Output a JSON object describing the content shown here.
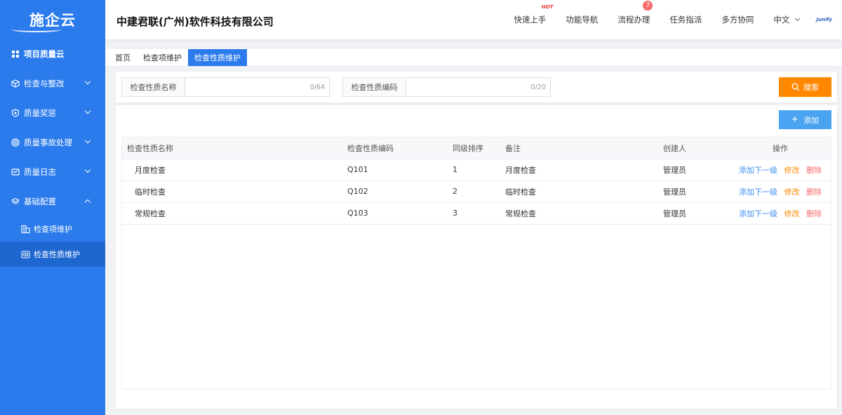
{
  "logo": {
    "text": "施企云"
  },
  "sidebar": {
    "items": [
      {
        "label": "项目质量云",
        "icon": "grid-icon"
      },
      {
        "label": "检查与整改",
        "icon": "cube-icon"
      },
      {
        "label": "质量奖惩",
        "icon": "shield-icon"
      },
      {
        "label": "质量事故处理",
        "icon": "target-icon"
      },
      {
        "label": "质量日志",
        "icon": "log-icon"
      },
      {
        "label": "基础配置",
        "icon": "layers-icon"
      }
    ],
    "sub_items": [
      {
        "label": "检查项维护",
        "icon": "building-icon"
      },
      {
        "label": "检查性质维护",
        "icon": "eye-card-icon"
      }
    ]
  },
  "header": {
    "company": "中建君联(广州)软件科技有限公司",
    "nav": {
      "quick_start": "快速上手",
      "hot": "HOT",
      "func_nav": "功能导航",
      "process": "流程办理",
      "process_badge": "7",
      "task": "任务指派",
      "collab": "多方协同",
      "lang": "中文",
      "brand": "Junify"
    }
  },
  "tabs": [
    {
      "label": "首页"
    },
    {
      "label": "检查项维护"
    },
    {
      "label": "检查性质维护"
    }
  ],
  "search": {
    "name_label": "检查性质名称",
    "name_count": "0/64",
    "code_label": "检查性质编码",
    "code_count": "0/20",
    "button": "搜索"
  },
  "toolbar": {
    "add": "添加"
  },
  "table": {
    "headers": {
      "name": "检查性质名称",
      "code": "检查性质编码",
      "order": "同级排序",
      "remark": "备注",
      "creator": "创建人",
      "op": "操作"
    },
    "rows": [
      {
        "name": "月度检查",
        "code": "Q101",
        "order": "1",
        "remark": "月度检查",
        "creator": "管理员"
      },
      {
        "name": "临时检查",
        "code": "Q102",
        "order": "2",
        "remark": "临时检查",
        "creator": "管理员"
      },
      {
        "name": "常规检查",
        "code": "Q103",
        "order": "3",
        "remark": "常规检查",
        "creator": "管理员"
      }
    ],
    "actions": {
      "add_child": "添加下一级",
      "edit": "修改",
      "delete": "删除"
    }
  },
  "colors": {
    "sidebar": "#2b7bec",
    "search_button": "#ff8800",
    "add_button": "#4aa3f0",
    "link": "#3d8ef0",
    "danger": "#f56c6c"
  }
}
